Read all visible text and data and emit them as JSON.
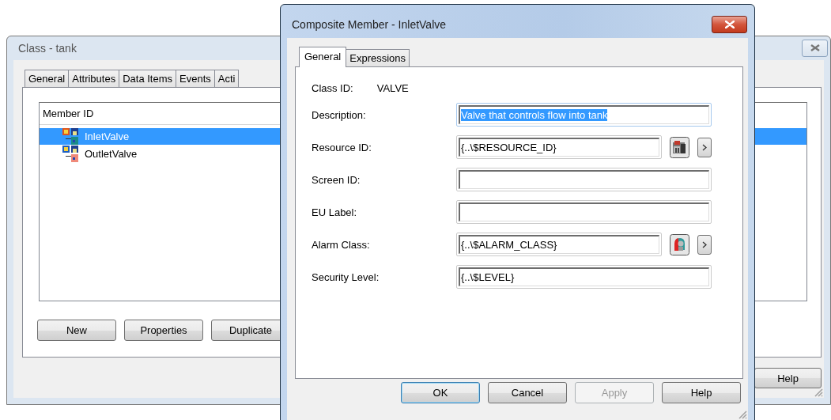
{
  "class_window": {
    "title": "Class - tank",
    "active": false,
    "tabs": [
      {
        "label": "General",
        "selected": false
      },
      {
        "label": "Attributes",
        "selected": false
      },
      {
        "label": "Data Items",
        "selected": false
      },
      {
        "label": "Events",
        "selected": false
      },
      {
        "label": "Acti",
        "selected": false
      }
    ],
    "member_list": {
      "header": "Member ID",
      "rows": [
        {
          "label": "InletValve",
          "selected": true
        },
        {
          "label": "OutletValve",
          "selected": false
        }
      ]
    },
    "buttons": [
      {
        "label": "New",
        "disabled": false
      },
      {
        "label": "Properties",
        "disabled": false
      },
      {
        "label": "Duplicate",
        "disabled": false
      }
    ],
    "footer_buttons": [
      {
        "label": "Help",
        "disabled": false
      }
    ]
  },
  "member_window": {
    "title": "Composite Member - InletValve",
    "active": true,
    "tabs": [
      {
        "label": "General",
        "selected": true
      },
      {
        "label": "Expressions",
        "selected": false
      }
    ],
    "class_id": {
      "label": "Class ID:",
      "value": "VALVE"
    },
    "fields": [
      {
        "label": "Description:",
        "value": "Valve that controls flow into tank",
        "kind": "plain",
        "focused": true,
        "text_selected": true
      },
      {
        "label": "Resource ID:",
        "value": "{..\\$RESOURCE_ID}",
        "kind": "resource",
        "focused": false,
        "text_selected": false
      },
      {
        "label": "Screen ID:",
        "kind": "plain",
        "focused": false
      },
      {
        "label": "EU Label:",
        "kind": "plain",
        "focused": false
      },
      {
        "label": "Alarm Class:",
        "value": "{..\\$ALARM_CLASS}",
        "kind": "alarm",
        "focused": false,
        "text_selected": false
      },
      {
        "label": "Security Level:",
        "value": "{..\\$LEVEL}",
        "kind": "plain",
        "focused": false,
        "text_selected": false
      }
    ],
    "buttons": [
      {
        "label": "OK",
        "default": true,
        "disabled": false
      },
      {
        "label": "Cancel",
        "default": false,
        "disabled": false
      },
      {
        "label": "Apply",
        "default": false,
        "disabled": true
      },
      {
        "label": "Help",
        "default": false,
        "disabled": false
      }
    ]
  }
}
